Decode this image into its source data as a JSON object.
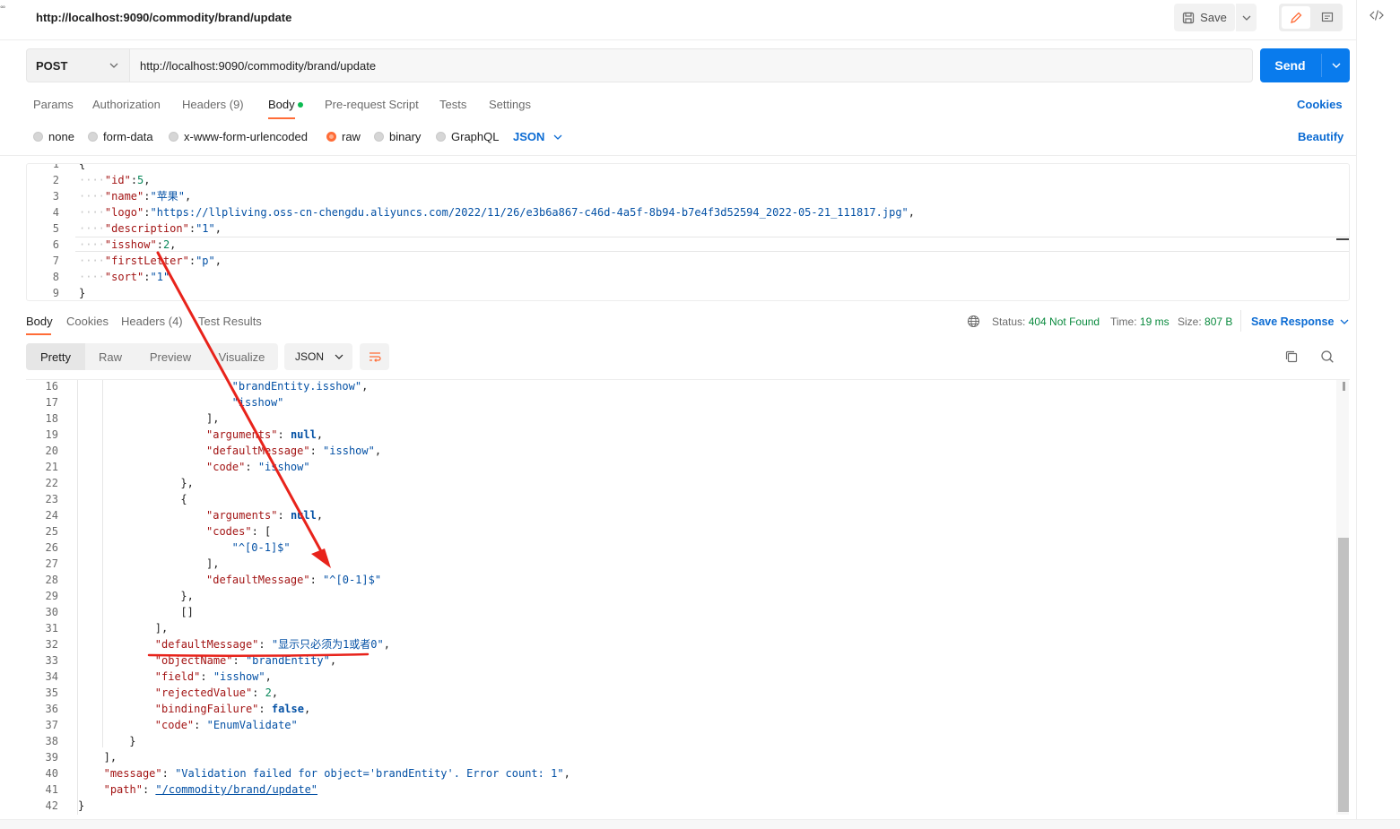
{
  "window": {
    "left_indicator": "°°"
  },
  "top_bar": {
    "title": "http://localhost:9090/commodity/brand/update",
    "save_label": "Save",
    "code_toggle_icon": "code-icon"
  },
  "request": {
    "method": "POST",
    "url": "http://localhost:9090/commodity/brand/update",
    "send_label": "Send",
    "tabs": [
      {
        "label": "Params"
      },
      {
        "label": "Authorization"
      },
      {
        "label": "Headers (9)"
      },
      {
        "label": "Body"
      },
      {
        "label": "Pre-request Script"
      },
      {
        "label": "Tests"
      },
      {
        "label": "Settings"
      }
    ],
    "active_tab": "Body",
    "cookies_label": "Cookies",
    "body_types": [
      {
        "label": "none"
      },
      {
        "label": "form-data"
      },
      {
        "label": "x-www-form-urlencoded"
      },
      {
        "label": "raw"
      },
      {
        "label": "binary"
      },
      {
        "label": "GraphQL"
      }
    ],
    "selected_body_type": "raw",
    "body_format": "JSON",
    "beautify_label": "Beautify",
    "body_lines": [
      {
        "n": "1",
        "text": "{"
      },
      {
        "n": "2",
        "key": "\"id\"",
        "val": "5",
        "vtype": "n",
        "tail": ","
      },
      {
        "n": "3",
        "key": "\"name\"",
        "val": "\"苹果\"",
        "vtype": "s",
        "tail": ","
      },
      {
        "n": "4",
        "key": "\"logo\"",
        "val": "\"https://llpliving.oss-cn-chengdu.aliyuncs.com/2022/11/26/e3b6a867-c46d-4a5f-8b94-b7e4f3d52594_2022-05-21_111817.jpg\"",
        "vtype": "s",
        "tail": ","
      },
      {
        "n": "5",
        "key": "\"description\"",
        "val": "\"1\"",
        "vtype": "s",
        "tail": ","
      },
      {
        "n": "6",
        "key": "\"isshow\"",
        "val": "2",
        "vtype": "n",
        "tail": ","
      },
      {
        "n": "7",
        "key": "\"firstLetter\"",
        "val": "\"p\"",
        "vtype": "s",
        "tail": ","
      },
      {
        "n": "8",
        "key": "\"sort\"",
        "val": "\"1\"",
        "vtype": "s",
        "tail": ""
      },
      {
        "n": "9",
        "text": "}"
      }
    ]
  },
  "response": {
    "tabs": [
      {
        "label": "Body"
      },
      {
        "label": "Cookies"
      },
      {
        "label": "Headers (4)"
      },
      {
        "label": "Test Results"
      }
    ],
    "active_tab": "Body",
    "status_label": "Status:",
    "status_value": "404 Not Found",
    "time_label": "Time:",
    "time_value": "19 ms",
    "size_label": "Size:",
    "size_value": "807 B",
    "save_response_label": "Save Response",
    "views": [
      {
        "label": "Pretty"
      },
      {
        "label": "Raw"
      },
      {
        "label": "Preview"
      },
      {
        "label": "Visualize"
      }
    ],
    "active_view": "Pretty",
    "format": "JSON",
    "lines": [
      {
        "n": "16",
        "indent": 6,
        "parts": [
          [
            "s",
            "\"brandEntity.isshow\""
          ],
          [
            "p",
            ","
          ]
        ]
      },
      {
        "n": "17",
        "indent": 6,
        "parts": [
          [
            "s",
            "\"isshow\""
          ]
        ]
      },
      {
        "n": "18",
        "indent": 5,
        "parts": [
          [
            "p",
            "],"
          ]
        ]
      },
      {
        "n": "19",
        "indent": 5,
        "parts": [
          [
            "k",
            "\"arguments\""
          ],
          [
            "p",
            ": "
          ],
          [
            "b",
            "null"
          ],
          [
            "p",
            ","
          ]
        ]
      },
      {
        "n": "20",
        "indent": 5,
        "parts": [
          [
            "k",
            "\"defaultMessage\""
          ],
          [
            "p",
            ": "
          ],
          [
            "s",
            "\"isshow\""
          ],
          [
            "p",
            ","
          ]
        ]
      },
      {
        "n": "21",
        "indent": 5,
        "parts": [
          [
            "k",
            "\"code\""
          ],
          [
            "p",
            ": "
          ],
          [
            "s",
            "\"isshow\""
          ]
        ]
      },
      {
        "n": "22",
        "indent": 4,
        "parts": [
          [
            "p",
            "},"
          ]
        ]
      },
      {
        "n": "23",
        "indent": 4,
        "parts": [
          [
            "p",
            "{"
          ]
        ]
      },
      {
        "n": "24",
        "indent": 5,
        "parts": [
          [
            "k",
            "\"arguments\""
          ],
          [
            "p",
            ": "
          ],
          [
            "b",
            "null"
          ],
          [
            "p",
            ","
          ]
        ]
      },
      {
        "n": "25",
        "indent": 5,
        "parts": [
          [
            "k",
            "\"codes\""
          ],
          [
            "p",
            ": ["
          ]
        ]
      },
      {
        "n": "26",
        "indent": 6,
        "parts": [
          [
            "s",
            "\"^[0-1]$\""
          ]
        ]
      },
      {
        "n": "27",
        "indent": 5,
        "parts": [
          [
            "p",
            "],"
          ]
        ]
      },
      {
        "n": "28",
        "indent": 5,
        "parts": [
          [
            "k",
            "\"defaultMessage\""
          ],
          [
            "p",
            ": "
          ],
          [
            "s",
            "\"^[0-1]$\""
          ]
        ]
      },
      {
        "n": "29",
        "indent": 4,
        "parts": [
          [
            "p",
            "},"
          ]
        ]
      },
      {
        "n": "30",
        "indent": 4,
        "parts": [
          [
            "p",
            "[]"
          ]
        ]
      },
      {
        "n": "31",
        "indent": 3,
        "parts": [
          [
            "p",
            "],"
          ]
        ]
      },
      {
        "n": "32",
        "indent": 3,
        "parts": [
          [
            "k",
            "\"defaultMessage\""
          ],
          [
            "p",
            ": "
          ],
          [
            "s",
            "\"显示只必须为1或者0\""
          ],
          [
            "p",
            ","
          ]
        ]
      },
      {
        "n": "33",
        "indent": 3,
        "parts": [
          [
            "k",
            "\"objectName\""
          ],
          [
            "p",
            ": "
          ],
          [
            "s",
            "\"brandEntity\""
          ],
          [
            "p",
            ","
          ]
        ]
      },
      {
        "n": "34",
        "indent": 3,
        "parts": [
          [
            "k",
            "\"field\""
          ],
          [
            "p",
            ": "
          ],
          [
            "s",
            "\"isshow\""
          ],
          [
            "p",
            ","
          ]
        ]
      },
      {
        "n": "35",
        "indent": 3,
        "parts": [
          [
            "k",
            "\"rejectedValue\""
          ],
          [
            "p",
            ": "
          ],
          [
            "n",
            "2"
          ],
          [
            "p",
            ","
          ]
        ]
      },
      {
        "n": "36",
        "indent": 3,
        "parts": [
          [
            "k",
            "\"bindingFailure\""
          ],
          [
            "p",
            ": "
          ],
          [
            "b",
            "false"
          ],
          [
            "p",
            ","
          ]
        ]
      },
      {
        "n": "37",
        "indent": 3,
        "parts": [
          [
            "k",
            "\"code\""
          ],
          [
            "p",
            ": "
          ],
          [
            "s",
            "\"EnumValidate\""
          ]
        ]
      },
      {
        "n": "38",
        "indent": 2,
        "parts": [
          [
            "p",
            "}"
          ]
        ]
      },
      {
        "n": "39",
        "indent": 1,
        "parts": [
          [
            "p",
            "],"
          ]
        ]
      },
      {
        "n": "40",
        "indent": 1,
        "parts": [
          [
            "k",
            "\"message\""
          ],
          [
            "p",
            ": "
          ],
          [
            "s",
            "\"Validation failed for object='brandEntity'. Error count: 1\""
          ],
          [
            "p",
            ","
          ]
        ]
      },
      {
        "n": "41",
        "indent": 1,
        "parts": [
          [
            "k",
            "\"path\""
          ],
          [
            "p",
            ": "
          ],
          [
            "u",
            "\"/commodity/brand/update\""
          ]
        ]
      },
      {
        "n": "42",
        "indent": 0,
        "parts": [
          [
            "p",
            "}"
          ]
        ]
      }
    ]
  },
  "colors": {
    "accent": "#ff6c37",
    "send": "#097bed",
    "link": "#0b6bd3",
    "status_ok": "#0a8a3e",
    "annotation": "#e8231b"
  }
}
